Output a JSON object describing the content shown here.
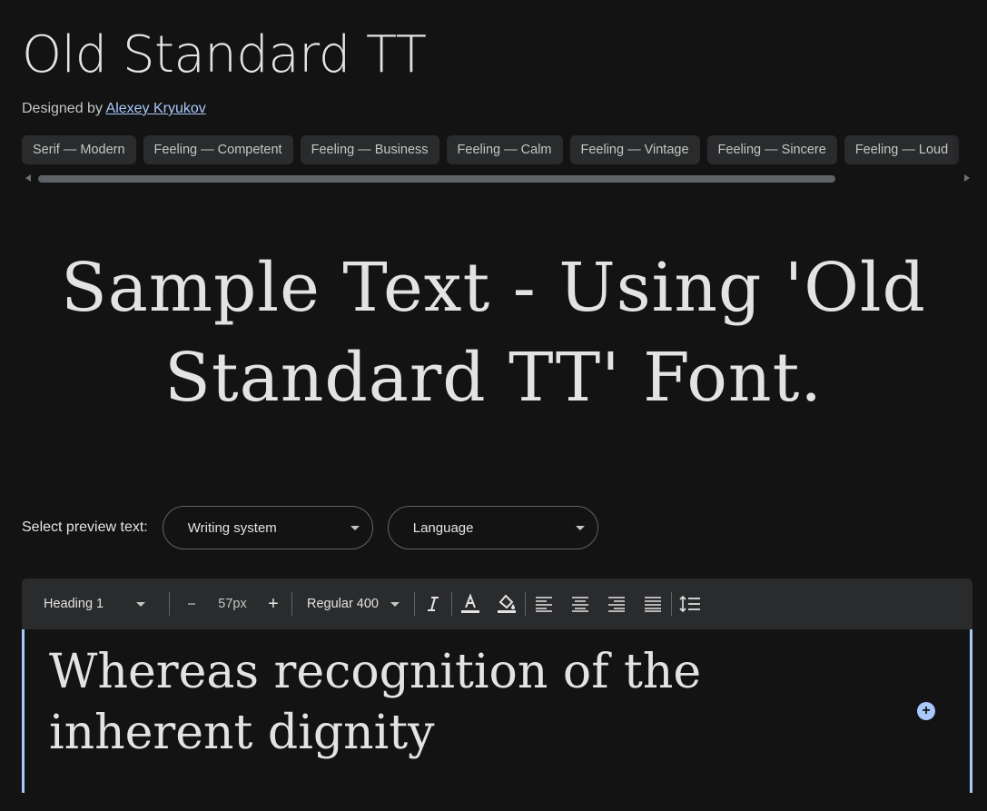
{
  "font": {
    "name": "Old Standard TT",
    "designed_by_label": "Designed by",
    "designer": "Alexey Kryukov"
  },
  "tags": [
    "Serif — Modern",
    "Feeling — Competent",
    "Feeling — Business",
    "Feeling — Calm",
    "Feeling — Vintage",
    "Feeling — Sincere",
    "Feeling — Loud"
  ],
  "sample_text": "Sample Text - Using 'Old Standard TT' Font.",
  "preview": {
    "label": "Select preview text:",
    "writing_system": "Writing system",
    "language": "Language"
  },
  "toolbar": {
    "style": "Heading 1",
    "decrease": "–",
    "size": "57px",
    "increase": "+",
    "weight": "Regular 400"
  },
  "editor": {
    "text": "Whereas recognition of the inherent dignity"
  },
  "colors": {
    "background": "#131313",
    "accent": "#a8c7fa",
    "chip": "#2a2b2d"
  }
}
